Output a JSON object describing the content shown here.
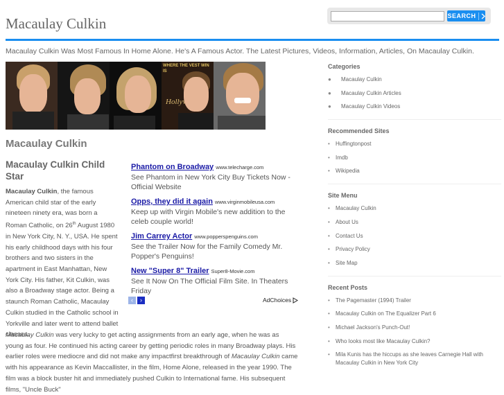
{
  "site": {
    "title": "Macaulay Culkin",
    "tagline": "Macaulay Culkin Was Most Famous In Home Alone. He's A Famous Actor. The Latest Pictures, Videos, Information, Articles, On Macaulay Culkin."
  },
  "search": {
    "placeholder": "",
    "button_label": "SEARCH"
  },
  "colors": {
    "accent": "#1a8ef0",
    "ad_link": "#1a1aa6"
  },
  "banner": {
    "overlay_text": [
      "WHERE",
      "THE",
      "VEST",
      "WIN",
      "IS",
      "Hollywood"
    ]
  },
  "main": {
    "heading": "Macaulay Culkin",
    "subheading": "Macaulay Culkin Child Star",
    "intro": {
      "bold_name": "Macaulay Culkin",
      "text1": ", the famous American child star of the early nineteen ninety era, was born a Roman Catholic, on 26",
      "sup": "th",
      "text2": " August 1980 in  New York City, N. Y., USA. He spent his early childhood days with his four brothers and two sisters in the apartment in East Manhattan, New York City. His father, Kit Culkin, was also a Broadway stage actor. Being a staunch Roman Catholic, Macaulay Culkin studied in the Catholic school in Yorkville and later went to attend ballet classes."
    },
    "para2": {
      "italic_name": "Macaulay Culkin",
      "text1": " was very lucky to get acting assignments from an early age, when he was as young as four. He continued his acting career by getting periodic roles in many Broadway plays. His earlier roles were mediocre and did not make any impactfirst breakthrough of ",
      "italic_name2": "Macaulay Culkin",
      "text2": " came with his appearance as Kevin Maccallister, in the film, Home Alone, released in the year 1990. The film was a block buster hit and immediately pushed Culkin to International fame. His subsequent films, \"Uncle Buck\""
    }
  },
  "ads": {
    "items": [
      {
        "title": "Phantom on Broadway",
        "url": "www.telecharge.com",
        "desc": "See Phantom in New York City Buy Tickets Now - Official Website"
      },
      {
        "title": "Opps, they did it again",
        "url": "www.virginmobileusa.com",
        "desc": "Keep up with Virgin Mobile's new addition to the celeb couple world!"
      },
      {
        "title": "Jim Carrey Actor",
        "url": "www.popperspenguins.com",
        "desc": "See the Trailer Now for the Family Comedy Mr. Popper's Penguins!"
      },
      {
        "title": "New \"Super 8\" Trailer",
        "url": "Super8-Movie.com",
        "desc": "See It Now On The Official Film Site. In Theaters Friday"
      }
    ],
    "prev_icon": "‹",
    "next_icon": "›",
    "adchoices_label": "AdChoices"
  },
  "sidebar": {
    "categories": {
      "title": "Categories",
      "items": [
        "Macaulay Culkin",
        "Macaulay Culkin Articles",
        "Macaulay Culkin Videos"
      ]
    },
    "recommended": {
      "title": "Recommended Sites",
      "items": [
        "Huffingtonpost",
        "Imdb",
        "Wikipedia"
      ]
    },
    "menu": {
      "title": "Site Menu",
      "items": [
        "Macaulay Culkin",
        "About Us",
        "Contact Us",
        "Privacy Policy",
        "Site Map"
      ]
    },
    "recent": {
      "title": "Recent Posts",
      "items": [
        "The Pagemaster (1994) Trailer",
        "Macaulay Culkin on The Equalizer Part 6",
        "Michael Jackson's Punch-Out!",
        "Who looks most like Macaulay Culkin?",
        "Mila Kunis has the hiccups as she leaves Carnegie Hall with Macaulay Culkin in New York City"
      ]
    }
  }
}
